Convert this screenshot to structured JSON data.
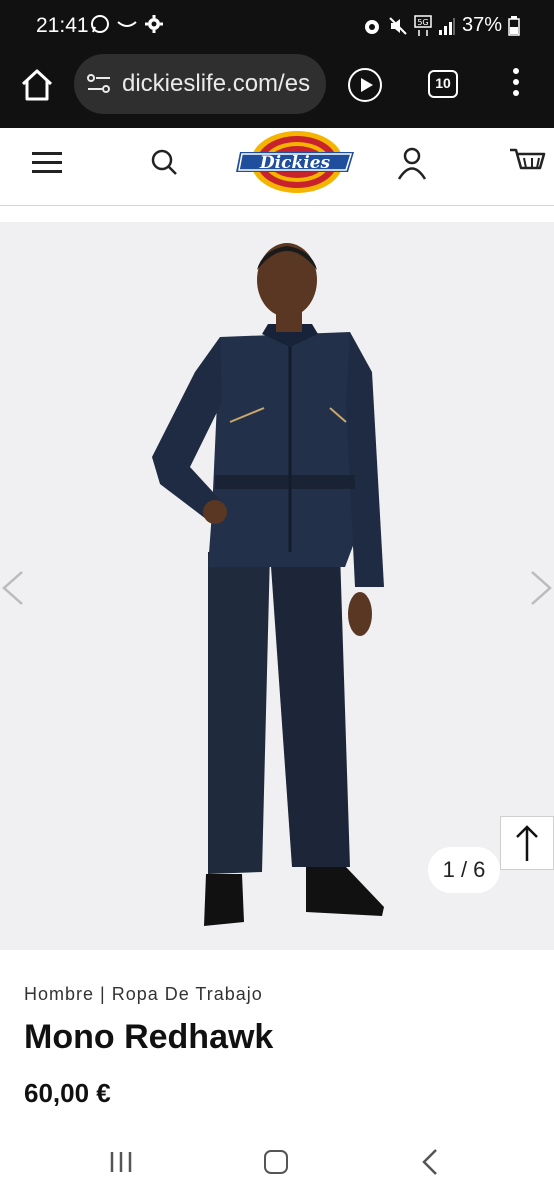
{
  "status_bar": {
    "time": "21:41",
    "battery": "37%",
    "left_icons": [
      "whatsapp-icon",
      "messages-icon",
      "settings-gear-icon"
    ],
    "right_icons": [
      "alarm-icon",
      "mute-icon",
      "5g-icon",
      "signal-icon",
      "battery-icon"
    ]
  },
  "browser": {
    "url": "dickieslife.com/es",
    "tab_count": "10"
  },
  "site_header": {
    "logo_text": "Dickies"
  },
  "product": {
    "image_counter": "1 / 6",
    "breadcrumb": "Hombre | Ropa De Trabajo",
    "title": "Mono Redhawk",
    "price": "60,00 €"
  },
  "colors": {
    "coverall": "#1f2a3d",
    "image_bg": "#f0f0f2",
    "logo_red": "#c8232c",
    "logo_yellow": "#f4b400",
    "logo_blue": "#1f4e9c"
  }
}
